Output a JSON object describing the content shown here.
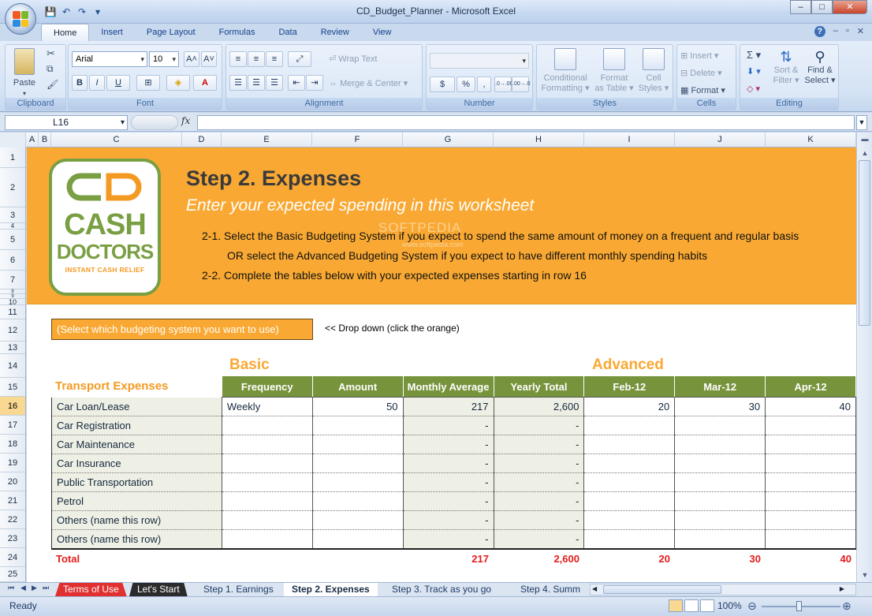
{
  "window": {
    "title": "CD_Budget_Planner - Microsoft Excel",
    "controls": {
      "minimize": "–",
      "maximize": "□",
      "close": "✕"
    },
    "qat": {
      "save": "💾",
      "undo": "↶",
      "redo": "↷",
      "more": "▾"
    }
  },
  "ribbon": {
    "tabs": [
      "Home",
      "Insert",
      "Page Layout",
      "Formulas",
      "Data",
      "Review",
      "View"
    ],
    "active_tab": "Home",
    "help": "?",
    "doc_controls": {
      "minimize": "–",
      "restore": "▫",
      "close": "✕"
    },
    "clipboard": {
      "paste": "Paste",
      "group": "Clipboard"
    },
    "font": {
      "name": "Arial",
      "size": "10",
      "grow": "A˄",
      "shrink": "A˅",
      "bold": "B",
      "italic": "I",
      "underline": "U",
      "borders": "⊞",
      "fill": "◈",
      "font_color": "A",
      "group": "Font"
    },
    "alignment": {
      "wrap": "Wrap Text",
      "merge": "Merge & Center",
      "group": "Alignment"
    },
    "number": {
      "format": "",
      "currency": "$",
      "percent": "%",
      "comma": ",",
      "inc_dec": ".0→.00",
      "dec_dec": ".00→.0",
      "group": "Number"
    },
    "styles": {
      "conditional": "Conditional",
      "conditional2": "Formatting",
      "format_table": "Format",
      "format_table2": "as Table",
      "cell_styles": "Cell",
      "cell_styles2": "Styles",
      "group": "Styles"
    },
    "cells": {
      "insert": "Insert",
      "delete": "Delete",
      "format": "Format",
      "group": "Cells"
    },
    "editing": {
      "sum": "Σ",
      "fill": "⬇",
      "clear": "◇",
      "sort": "Sort &",
      "sort2": "Filter",
      "find": "Find &",
      "find2": "Select",
      "group": "Editing"
    }
  },
  "formula_bar": {
    "name_box": "L16",
    "fx": "fx",
    "content": ""
  },
  "columns": [
    "A",
    "B",
    "C",
    "D",
    "E",
    "F",
    "G",
    "H",
    "I",
    "J",
    "K"
  ],
  "rows": [
    "1",
    "2",
    "3",
    "4",
    "5",
    "6",
    "7",
    "8",
    "9",
    "10",
    "11",
    "12",
    "13",
    "14",
    "15",
    "16",
    "17",
    "18",
    "19",
    "20",
    "21",
    "22",
    "23",
    "24",
    "25"
  ],
  "selected_row": "16",
  "banner": {
    "logo_cd": "CD",
    "logo_cash": "CASH",
    "logo_doctors": "DOCTORS",
    "logo_tag": "INSTANT CASH RELIEF",
    "title": "Step 2. Expenses",
    "subtitle": "Enter your expected spending in this worksheet",
    "line1": "2-1.  Select the Basic Budgeting System if you expect to spend the same amount of money on a frequent and regular basis",
    "line2": "OR select the Advanced Budgeting System if you expect to have different monthly spending habits",
    "line3": "2-2.  Complete the tables below with your expected expenses starting in row 16",
    "watermark": "SOFTPEDIA",
    "watermark_url": "www.softpedia.com"
  },
  "selector": {
    "box": "(Select which budgeting system you want to use)",
    "hint": "<< Drop down (click the orange)"
  },
  "section": {
    "basic": "Basic",
    "advanced": "Advanced",
    "category": "Transport Expenses"
  },
  "table": {
    "headers": [
      "Frequency",
      "Amount",
      "Monthly Average",
      "Yearly Total",
      "Feb-12",
      "Mar-12",
      "Apr-12"
    ],
    "rows": [
      {
        "label": "Car Loan/Lease",
        "frequency": "Weekly",
        "amount": "50",
        "monthly": "217",
        "yearly": "2,600",
        "feb": "20",
        "mar": "30",
        "apr": "40"
      },
      {
        "label": "Car Registration",
        "frequency": "",
        "amount": "",
        "monthly": "-",
        "yearly": "-",
        "feb": "",
        "mar": "",
        "apr": ""
      },
      {
        "label": "Car Maintenance",
        "frequency": "",
        "amount": "",
        "monthly": "-",
        "yearly": "-",
        "feb": "",
        "mar": "",
        "apr": ""
      },
      {
        "label": "Car Insurance",
        "frequency": "",
        "amount": "",
        "monthly": "-",
        "yearly": "-",
        "feb": "",
        "mar": "",
        "apr": ""
      },
      {
        "label": "Public Transportation",
        "frequency": "",
        "amount": "",
        "monthly": "-",
        "yearly": "-",
        "feb": "",
        "mar": "",
        "apr": ""
      },
      {
        "label": "Petrol",
        "frequency": "",
        "amount": "",
        "monthly": "-",
        "yearly": "-",
        "feb": "",
        "mar": "",
        "apr": ""
      },
      {
        "label": "Others (name this row)",
        "frequency": "",
        "amount": "",
        "monthly": "-",
        "yearly": "-",
        "feb": "",
        "mar": "",
        "apr": ""
      },
      {
        "label": "Others (name this row)",
        "frequency": "",
        "amount": "",
        "monthly": "-",
        "yearly": "-",
        "feb": "",
        "mar": "",
        "apr": ""
      }
    ],
    "total": {
      "label": "Total",
      "monthly": "217",
      "yearly": "2,600",
      "feb": "20",
      "mar": "30",
      "apr": "40"
    }
  },
  "sheet_tabs": [
    "Terms of Use",
    "Let's Start",
    "Step 1. Earnings",
    "Step 2. Expenses",
    "Step 3. Track as you go",
    "Step 4. Summ"
  ],
  "active_sheet": "Step 2. Expenses",
  "status": {
    "text": "Ready",
    "zoom": "100%",
    "zoom_out": "⊖",
    "zoom_in": "⊕"
  },
  "colors": {
    "banner": "#f9a933",
    "header_green": "#77933c",
    "total_red": "#e31b1b",
    "logo_green": "#7a9f43"
  }
}
